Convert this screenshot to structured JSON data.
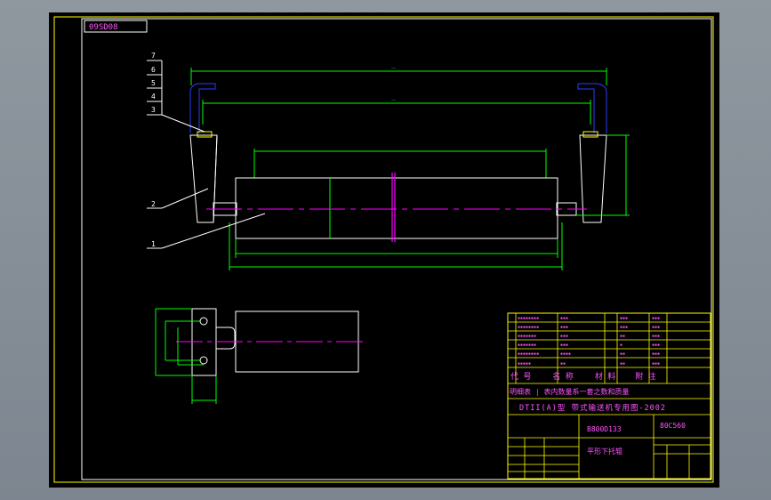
{
  "drawing": {
    "drawing_no_box": "09SD08",
    "colors": {
      "background": "#000000",
      "frame": "#ffff00",
      "line": "#ffffff",
      "dimension": "#00ff00",
      "centerline": "#ff00ff",
      "hidden": "#2b3cff"
    },
    "balloons": [
      "7",
      "6",
      "5",
      "4",
      "3",
      "2",
      "1"
    ],
    "title_block": {
      "standard_row": "DTII(A)型  带式输送机专用图-2002",
      "code_left": "B800D133",
      "code_right": "80C560",
      "part_name": "平形下托辊",
      "header_row": [
        "代 号",
        "名 称",
        "材 料",
        "附 注"
      ],
      "sub_row": "明细表  |  表内数量系一套之数和质量"
    }
  }
}
